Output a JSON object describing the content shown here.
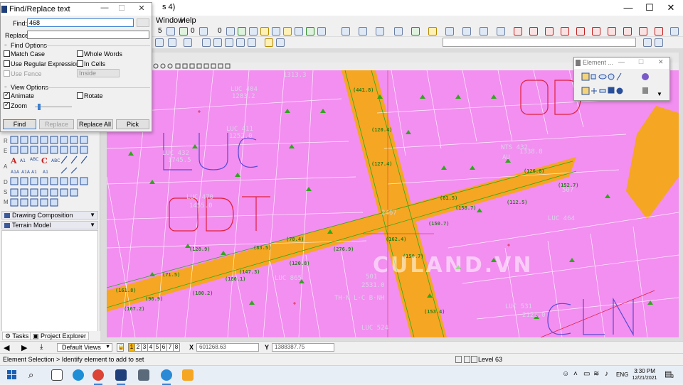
{
  "app": {
    "title_fragment": "s 4)",
    "window_controls": {
      "minimize": "—",
      "maximize": "☐",
      "close": "✕"
    }
  },
  "menu": {
    "items": [
      "Window",
      "Help"
    ]
  },
  "toolbar": {
    "active_level_1": "5",
    "active_level_2": "0",
    "active_level_3": "0"
  },
  "find_dialog": {
    "title": "Find/Replace text",
    "find_label": "Find:",
    "find_value": "468",
    "replace_label": "Replace:",
    "replace_value": "",
    "find_options_label": "Find Options",
    "options": [
      {
        "label": "Match Case",
        "checked": false,
        "disabled": false
      },
      {
        "label": "Whole Words",
        "checked": false,
        "disabled": false
      },
      {
        "label": "Use Regular Expressions",
        "checked": false,
        "disabled": false
      },
      {
        "label": "In Cells",
        "checked": false,
        "disabled": false
      },
      {
        "label": "Use Fence",
        "checked": false,
        "disabled": true
      }
    ],
    "fence_mode": "Inside",
    "view_options_label": "View Options",
    "view_options": [
      {
        "label": "Animate",
        "checked": true
      },
      {
        "label": "Rotate",
        "checked": false
      },
      {
        "label": "Zoom",
        "checked": true
      }
    ],
    "zoom_level": 0.1,
    "buttons": {
      "find": "Find",
      "replace": "Replace",
      "replace_all": "Replace All",
      "pick": "Pick"
    }
  },
  "left_panel": {
    "side_letters": [
      "R",
      "E",
      "A",
      "D",
      "S",
      "M"
    ],
    "headers": [
      "Drawing Composition",
      "Terrain Model"
    ],
    "tabs": [
      "Tasks",
      "Project Explorer"
    ]
  },
  "element_box": {
    "title": "Element ..."
  },
  "map": {
    "watermark": "CULAND.VN",
    "zone_labels": [
      "LUC",
      "ODT",
      "ODT",
      "CLN"
    ],
    "parcel_labels": [
      {
        "text": "1313.3"
      },
      {
        "text": "LUC 404"
      },
      {
        "text": "1283.2"
      },
      {
        "text": "LUC 411"
      },
      {
        "text": "1252.0"
      },
      {
        "text": "LUC 432"
      },
      {
        "text": "1745.5"
      },
      {
        "text": "LUC 470"
      },
      {
        "text": "1455.0"
      },
      {
        "text": "2467"
      },
      {
        "text": "NTS 432"
      },
      {
        "text": "1338.8"
      },
      {
        "text": "507"
      },
      {
        "text": "LUC 464"
      },
      {
        "text": "501"
      },
      {
        "text": "2531.0"
      },
      {
        "text": "LUC 531"
      },
      {
        "text": "2121.0"
      },
      {
        "text": "LUC 524"
      },
      {
        "text": "TH·N L·C B·NH"
      },
      {
        "text": "LUC 865"
      },
      {
        "text": "AU"
      }
    ],
    "area_labels": [
      "(441.8)",
      "(120.4)",
      "(127.4)",
      "(126.8)",
      "(112.5)",
      "(152.7)",
      "(162.4)",
      "(150.7)",
      "(81.5)",
      "(158.7)",
      "(150.7)",
      "(78.4)",
      "(276.9)",
      "(83.5)",
      "(71.5)",
      "(180.1)",
      "(180.2)",
      "(147.3)",
      "(161.8)",
      "(120.8)",
      "(167.2)",
      "(153.4)",
      "(128.9)",
      "(96.9)"
    ]
  },
  "view_bar": {
    "view_buttons": [
      "1",
      "2",
      "3",
      "4",
      "5",
      "6",
      "7",
      "8"
    ],
    "active_view": "1",
    "views_combo": "Default Views",
    "x_label": "X",
    "x_value": "601268.63",
    "y_label": "Y",
    "y_value": "1388387.75"
  },
  "status_bar": {
    "prompt": "Element Selection > Identify element to add to set",
    "level": "Level 63"
  },
  "taskbar": {
    "language": "ENG",
    "time": "3:30 PM",
    "date": "12/21/2021",
    "notification_count": "3"
  },
  "colors": {
    "map_pink": "#f28ff0",
    "road_orange": "#f5a623",
    "zone_purple": "#5a4ad0",
    "zone_red": "#e0203a",
    "area_green": "#2ea81a"
  }
}
